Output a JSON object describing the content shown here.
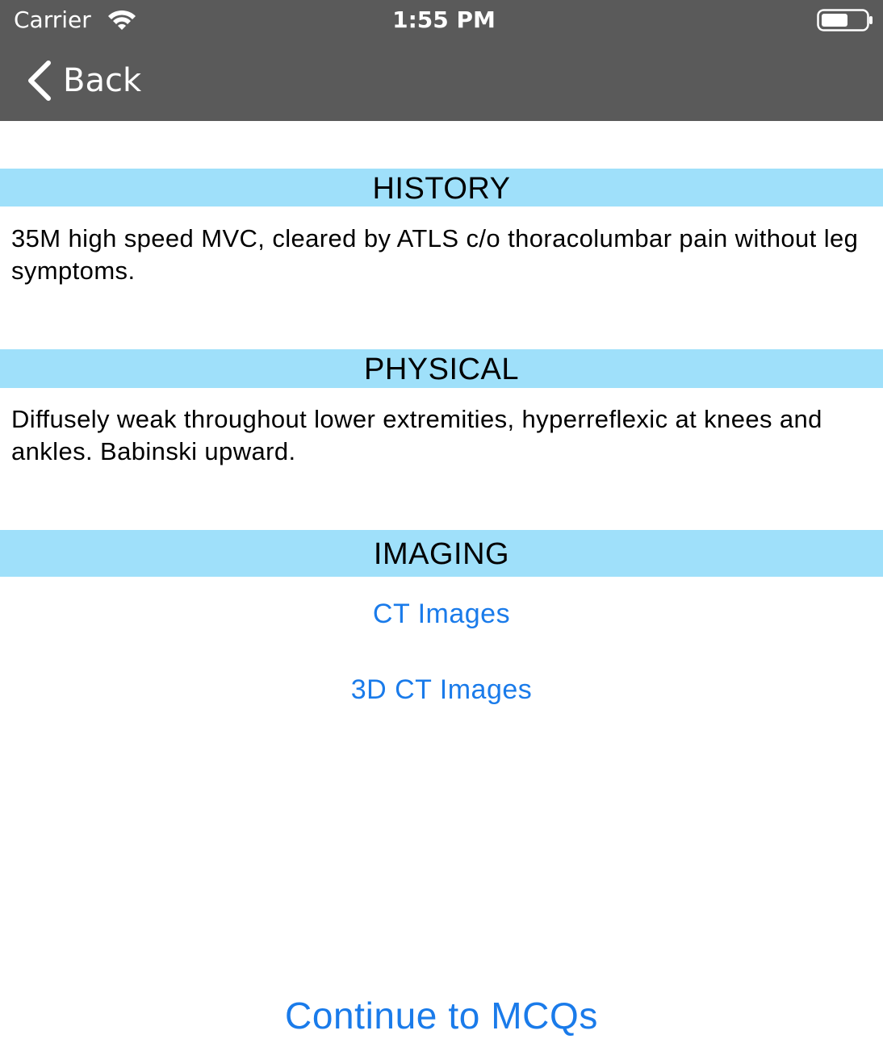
{
  "status_bar": {
    "carrier": "Carrier",
    "time": "1:55 PM",
    "icons": [
      "wifi-icon",
      "battery-icon"
    ]
  },
  "nav": {
    "back_label": "Back",
    "back_icon": "chevron-left-icon"
  },
  "sections": {
    "history": {
      "title": "HISTORY",
      "text": "35M high speed MVC, cleared by ATLS c/o thoracolumbar pain without leg symptoms."
    },
    "physical": {
      "title": "PHYSICAL",
      "text": "Diffusely weak throughout lower extremities, hyperreflexic at knees and ankles. Babinski upward."
    },
    "imaging": {
      "title": "IMAGING",
      "links": [
        "CT Images",
        "3D CT Images"
      ]
    }
  },
  "continue_label": "Continue to MCQs",
  "colors": {
    "top_bar": "#5a5a5a",
    "section_header": "#9fe0fa",
    "link": "#1a7bea"
  }
}
